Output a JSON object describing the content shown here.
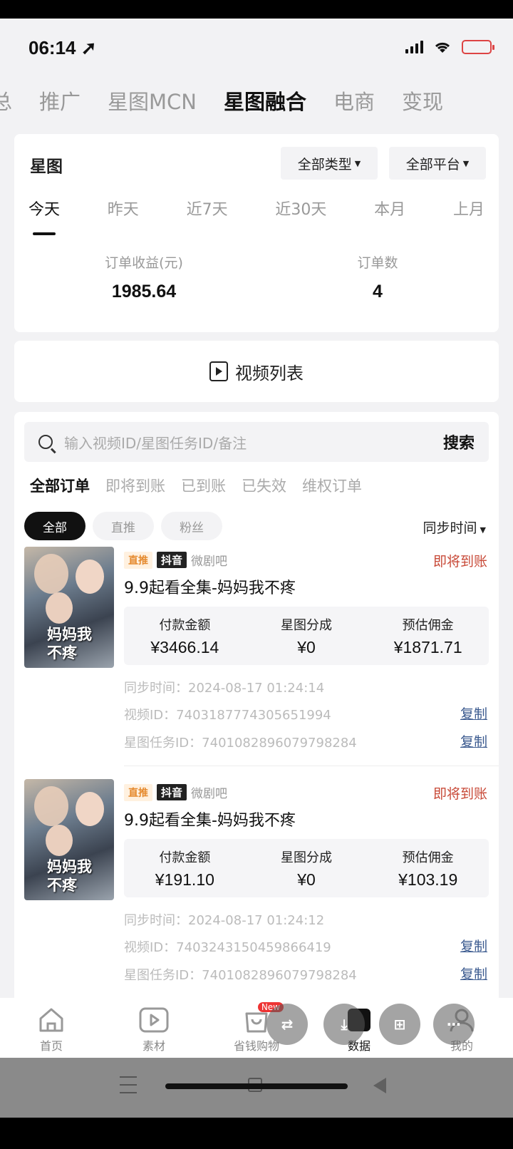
{
  "status_bar": {
    "time": "06:14 ➚"
  },
  "top_tabs": [
    "总",
    "推广",
    "星图MCN",
    "星图融合",
    "电商",
    "变现"
  ],
  "summary": {
    "title": "星图",
    "type_filter": "全部类型",
    "platform_filter": "全部平台",
    "date_tabs": [
      "今天",
      "昨天",
      "近7天",
      "近30天",
      "本月",
      "上月"
    ],
    "metrics": [
      {
        "label": "订单收益(元)",
        "value": "1985.64"
      },
      {
        "label": "订单数",
        "value": "4"
      }
    ]
  },
  "video_list_label": "视频列表",
  "orders_panel": {
    "search_placeholder": "输入视频ID/星图任务ID/备注",
    "search_button": "搜索",
    "status_tabs": [
      "全部订单",
      "即将到账",
      "已到账",
      "已失效",
      "维权订单"
    ],
    "chips": [
      "全部",
      "直推",
      "粉丝"
    ],
    "sort_label": "同步时间"
  },
  "orders": [
    {
      "tag_type": "直推",
      "tag_platform": "抖音",
      "source": "微剧吧",
      "status": "即将到账",
      "thumb_text": "妈妈我不疼",
      "title": "9.9起看全集-妈妈我不疼",
      "amount_labels": [
        "付款金额",
        "星图分成",
        "预估佣金"
      ],
      "amounts": [
        "¥3466.14",
        "¥0",
        "¥1871.71"
      ],
      "sync_time": "同步时间：2024-08-17 01:24:14",
      "video_id": "视频ID：7403187774305651994",
      "task_id": "星图任务ID：7401082896079798284",
      "copy_label": "复制"
    },
    {
      "tag_type": "直推",
      "tag_platform": "抖音",
      "source": "微剧吧",
      "status": "即将到账",
      "thumb_text": "妈妈我不疼",
      "title": "9.9起看全集-妈妈我不疼",
      "amount_labels": [
        "付款金额",
        "星图分成",
        "预估佣金"
      ],
      "amounts": [
        "¥191.10",
        "¥0",
        "¥103.19"
      ],
      "sync_time": "同步时间：2024-08-17 01:24:12",
      "video_id": "视频ID：7403243150459866419",
      "task_id": "星图任务ID：7401082896079798284",
      "copy_label": "复制"
    }
  ],
  "bottom_nav": [
    "首页",
    "素材",
    "省钱购物",
    "数据",
    "我的"
  ],
  "new_badge": "New",
  "accent_color": "#c84a38"
}
